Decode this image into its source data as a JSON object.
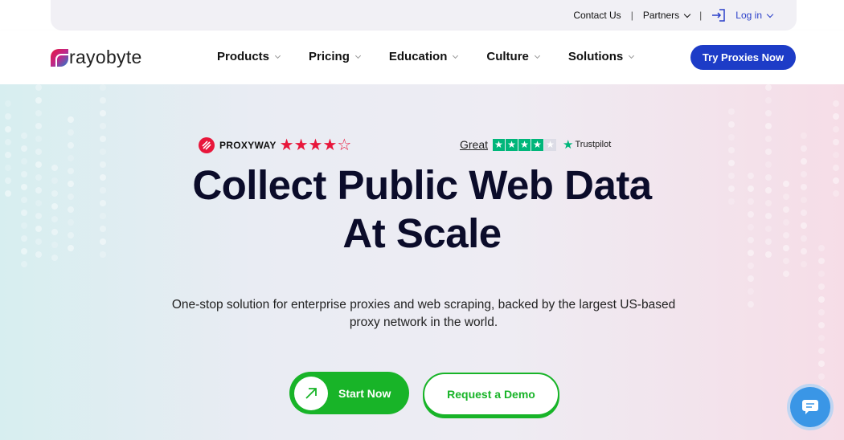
{
  "utility": {
    "contact": "Contact Us",
    "partners": "Partners",
    "login": "Log in"
  },
  "brand": {
    "name": "rayobyte",
    "accent": "#e8173b",
    "primary": "#1d3cc7",
    "green": "#18b428"
  },
  "nav": {
    "items": [
      {
        "label": "Products"
      },
      {
        "label": "Pricing"
      },
      {
        "label": "Education"
      },
      {
        "label": "Culture"
      },
      {
        "label": "Solutions"
      }
    ],
    "cta": "Try Proxies Now"
  },
  "ratings": {
    "proxyway_name": "PROXYWAY",
    "proxyway_stars": 4,
    "proxyway_max": 5,
    "trustpilot_label": "Great",
    "trustpilot_stars": 4,
    "trustpilot_brand": "Trustpilot"
  },
  "hero": {
    "headline_line1": "Collect Public Web Data",
    "headline_line2": "At Scale",
    "subtext": "One-stop solution for enterprise proxies and web scraping, backed by the largest US-based proxy network in the world.",
    "primary_cta": "Start Now",
    "secondary_cta": "Request a Demo"
  },
  "icons": [
    "login-icon",
    "chevron-down-icon",
    "arrow-up-right-icon",
    "chat-icon",
    "star-icon"
  ]
}
